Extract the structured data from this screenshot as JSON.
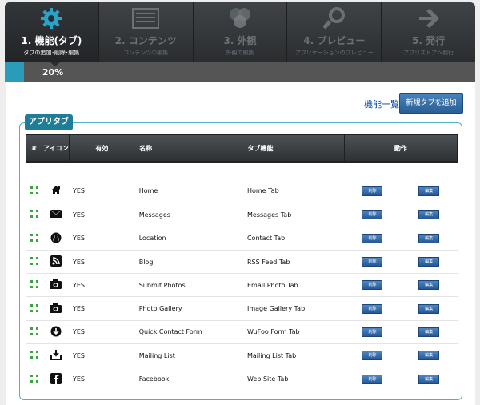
{
  "wizard": {
    "steps": [
      {
        "title": "1. 機能(タブ)",
        "sub": "タブの追加･削除･編集",
        "icon": "gear-icon"
      },
      {
        "title": "2. コンテンツ",
        "sub": "コンテンツの編集",
        "icon": "content-icon"
      },
      {
        "title": "3. 外観",
        "sub": "外観の編集",
        "icon": "circles-icon"
      },
      {
        "title": "4. プレビュー",
        "sub": "アプリケーションのプレビュー",
        "icon": "magnifier-icon"
      },
      {
        "title": "5. 発行",
        "sub": "アプリストアへ発行",
        "icon": "arrow-right-icon"
      }
    ],
    "progress_label": "20%",
    "progress": 0.2
  },
  "top": {
    "list_link": "機能一覧",
    "new_button": "新規タブを追加"
  },
  "section": {
    "legend": "アプリタブ"
  },
  "table": {
    "headers": {
      "num": "#",
      "icon": "アイコン",
      "enabled": "有効",
      "name": "名称",
      "function": "タブ機能",
      "action": "動作"
    },
    "delete_label": "削除",
    "edit_label": "編集",
    "rows": [
      {
        "icon": "home-icon",
        "enabled": "YES",
        "name": "Home",
        "function": "Home Tab"
      },
      {
        "icon": "envelope-icon",
        "enabled": "YES",
        "name": "Messages",
        "function": "Messages Tab"
      },
      {
        "icon": "globe-icon",
        "enabled": "YES",
        "name": "Location",
        "function": "Contact Tab"
      },
      {
        "icon": "rss-icon",
        "enabled": "YES",
        "name": "Blog",
        "function": "RSS Feed Tab"
      },
      {
        "icon": "camera-icon",
        "enabled": "YES",
        "name": "Submit Photos",
        "function": "Email Photo Tab"
      },
      {
        "icon": "camera-icon",
        "enabled": "YES",
        "name": "Photo Gallery",
        "function": "Image Gallery Tab"
      },
      {
        "icon": "download-icon",
        "enabled": "YES",
        "name": "Quick Contact Form",
        "function": "WuFoo Form Tab"
      },
      {
        "icon": "inbox-download-icon",
        "enabled": "YES",
        "name": "Mailing List",
        "function": "Mailing List Tab"
      },
      {
        "icon": "facebook-icon",
        "enabled": "YES",
        "name": "Facebook",
        "function": "Web Site Tab"
      }
    ]
  }
}
